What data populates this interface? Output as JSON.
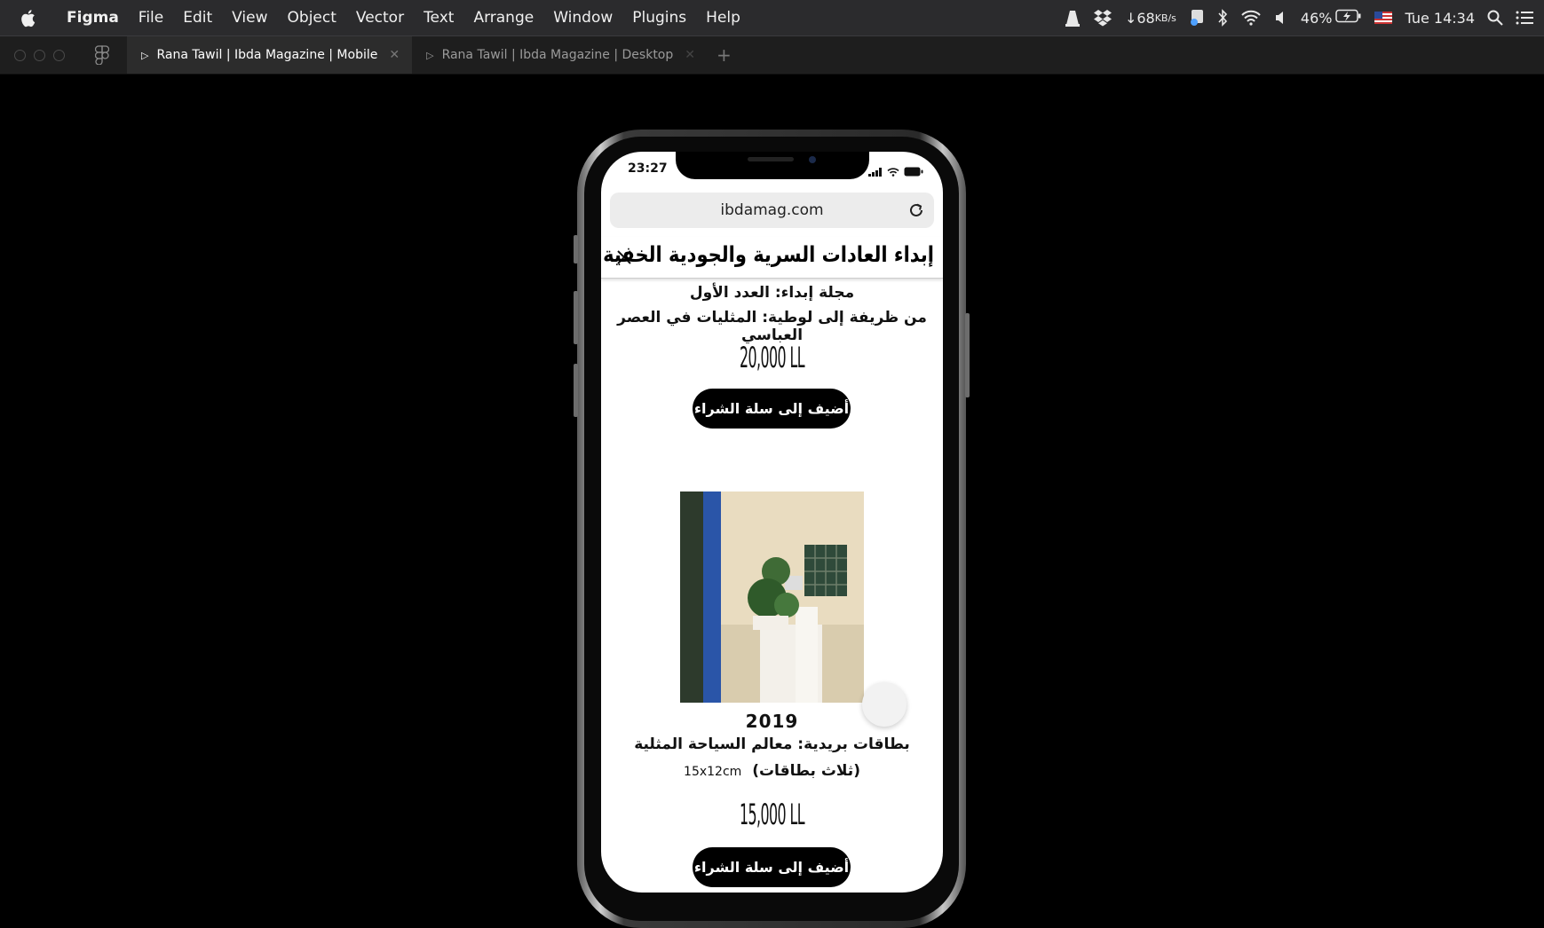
{
  "menubar": {
    "app": "Figma",
    "items": [
      "File",
      "Edit",
      "View",
      "Object",
      "Vector",
      "Text",
      "Arrange",
      "Window",
      "Plugins",
      "Help"
    ],
    "status": {
      "net_speed": "↓68",
      "net_unit": "KB/s",
      "battery": "46%",
      "clock": "Tue 14:34"
    }
  },
  "tabs": [
    {
      "label": "Rana Tawil | Ibda Magazine | Mobile",
      "active": true
    },
    {
      "label": "Rana Tawil | Ibda Magazine | Desktop",
      "active": false
    }
  ],
  "phone": {
    "status_time": "23:27",
    "url": "ibdamag.com",
    "site_title": "إبداء العادات السرية والجودية الخفية",
    "product1": {
      "title_line1": "مجلة إبداء: العدد الأول",
      "title_line2": "من ظريفة إلى لوطية: المثليات في العصر العباسي",
      "price": "20,000 LL",
      "button": "أضيف إلى سلة الشراء"
    },
    "product2": {
      "year": "2019",
      "title_line1": "بطاقات بريدية: معالم السياحة المثلية",
      "title_line2": "(ثلاث بطاقات)",
      "dims": "15x12cm",
      "price": "15,000 LL",
      "button": "أضيف إلى سلة الشراء"
    }
  }
}
